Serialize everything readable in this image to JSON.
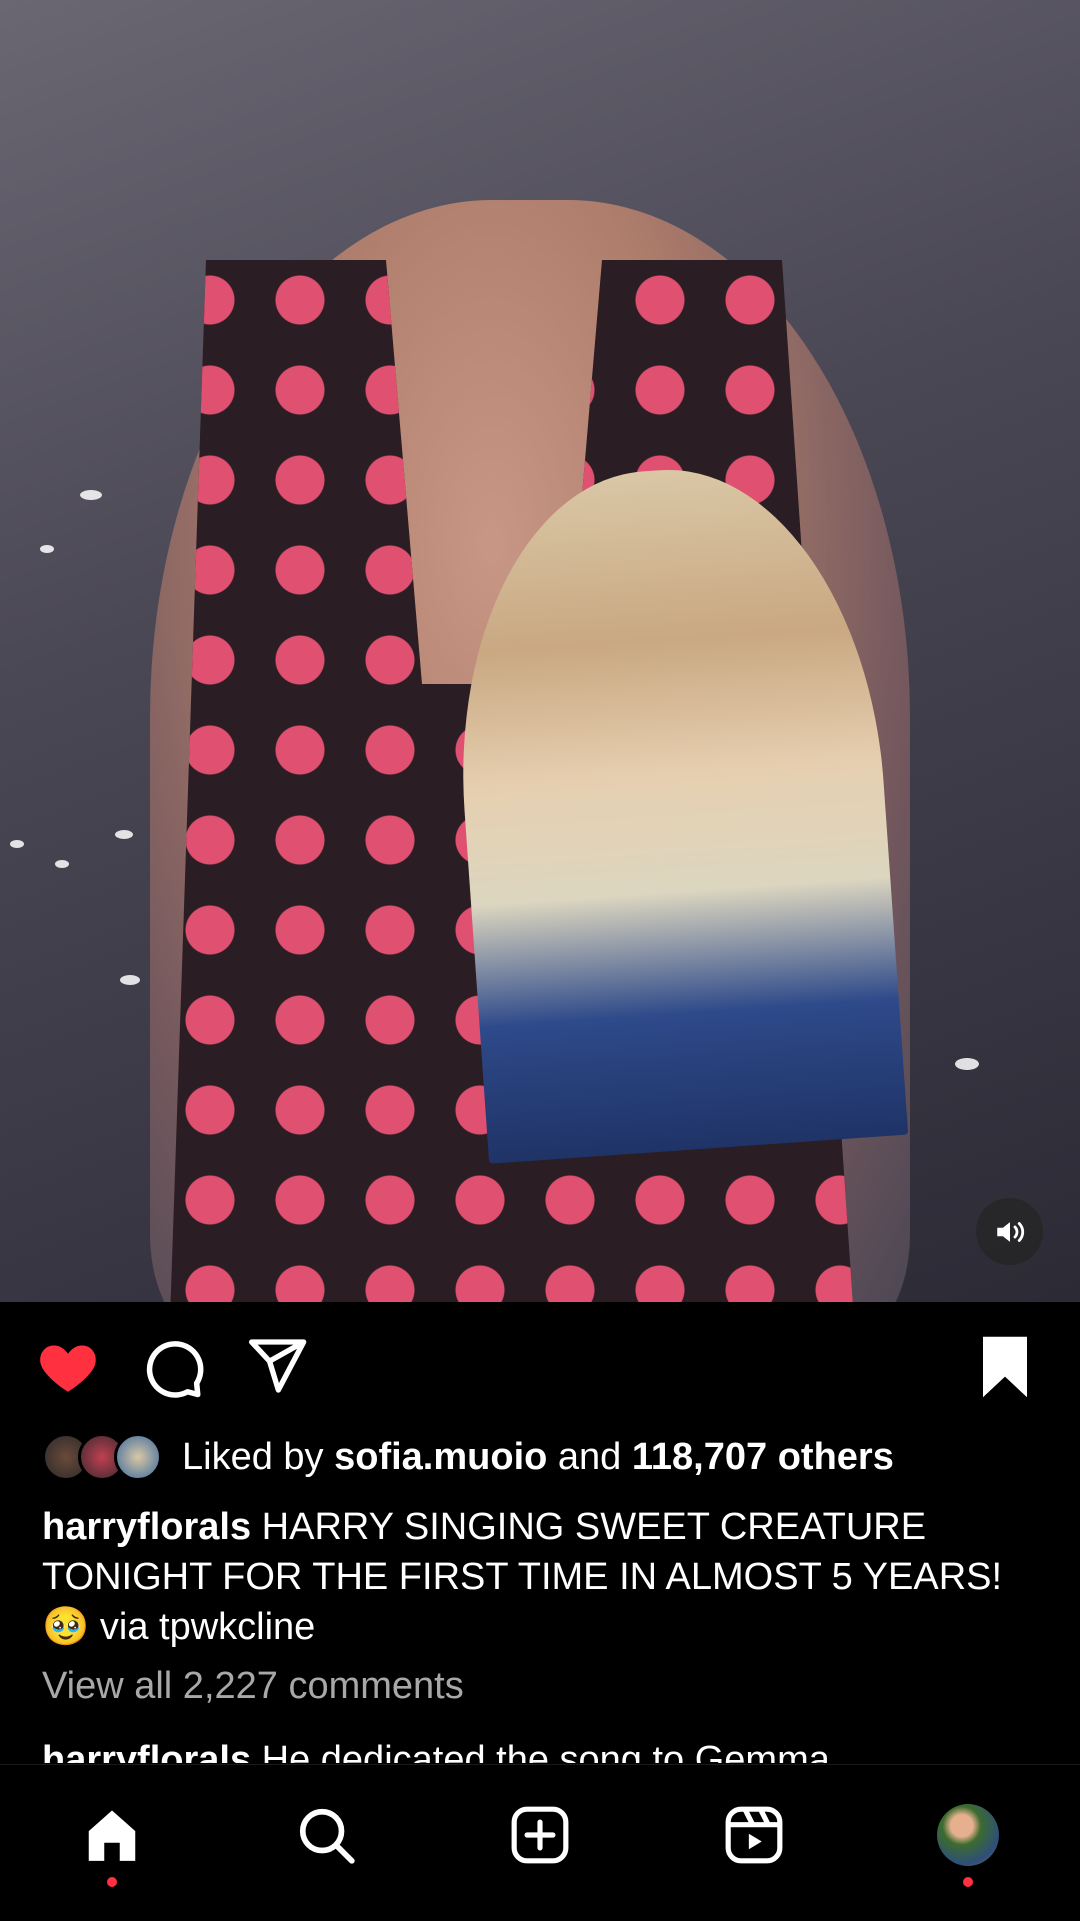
{
  "post": {
    "media_description_icon": "video",
    "mute_icon": "speaker-icon",
    "likes": {
      "prefix": "Liked by",
      "user": "sofia.muoio",
      "conj": "and",
      "count": "118,707 others"
    },
    "caption": {
      "username": "harryflorals",
      "text": "HARRY SINGING SWEET CREATURE TONIGHT FOR THE FIRST TIME IN ALMOST 5 YEARS! 🥹 via tpwkcline"
    },
    "view_comments": "View all 2,227 comments",
    "comment_preview": {
      "username": "harryflorals",
      "text": "He dedicated the song to Gemma"
    }
  },
  "actions": {
    "liked": true,
    "saved": true,
    "like_color": "#ff3040"
  },
  "tabbar": {
    "items": [
      "home-icon",
      "search-icon",
      "create-icon",
      "reels-icon",
      "profile-avatar"
    ],
    "active": "home",
    "notification_dot_color": "#ff3040"
  }
}
